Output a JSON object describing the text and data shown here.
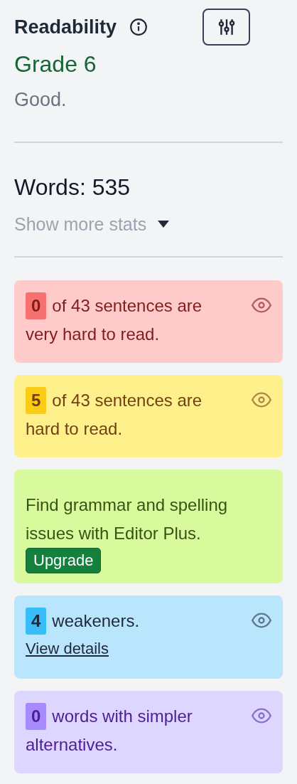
{
  "header": {
    "title": "Readability"
  },
  "grade": "Grade 6",
  "verdict": "Good.",
  "words": "Words: 535",
  "stats_toggle": {
    "label": "Show more stats",
    "expanded": false
  },
  "cards": [
    {
      "kind": "very_hard",
      "count": "0",
      "lines": [
        "of 43 sentences are",
        "very hard to read."
      ]
    },
    {
      "kind": "hard",
      "count": "5",
      "lines": [
        "of 43 sentences are",
        "hard to read."
      ]
    },
    {
      "kind": "promo",
      "lines": [
        "Find grammar and spelling issues with Editor Plus."
      ],
      "button": "Upgrade"
    },
    {
      "kind": "weakeners",
      "count": "4",
      "lines": [
        "weakeners."
      ],
      "link": "View details"
    },
    {
      "kind": "simpler",
      "count": "0",
      "lines": [
        "words with simpler",
        "alternatives."
      ]
    }
  ]
}
